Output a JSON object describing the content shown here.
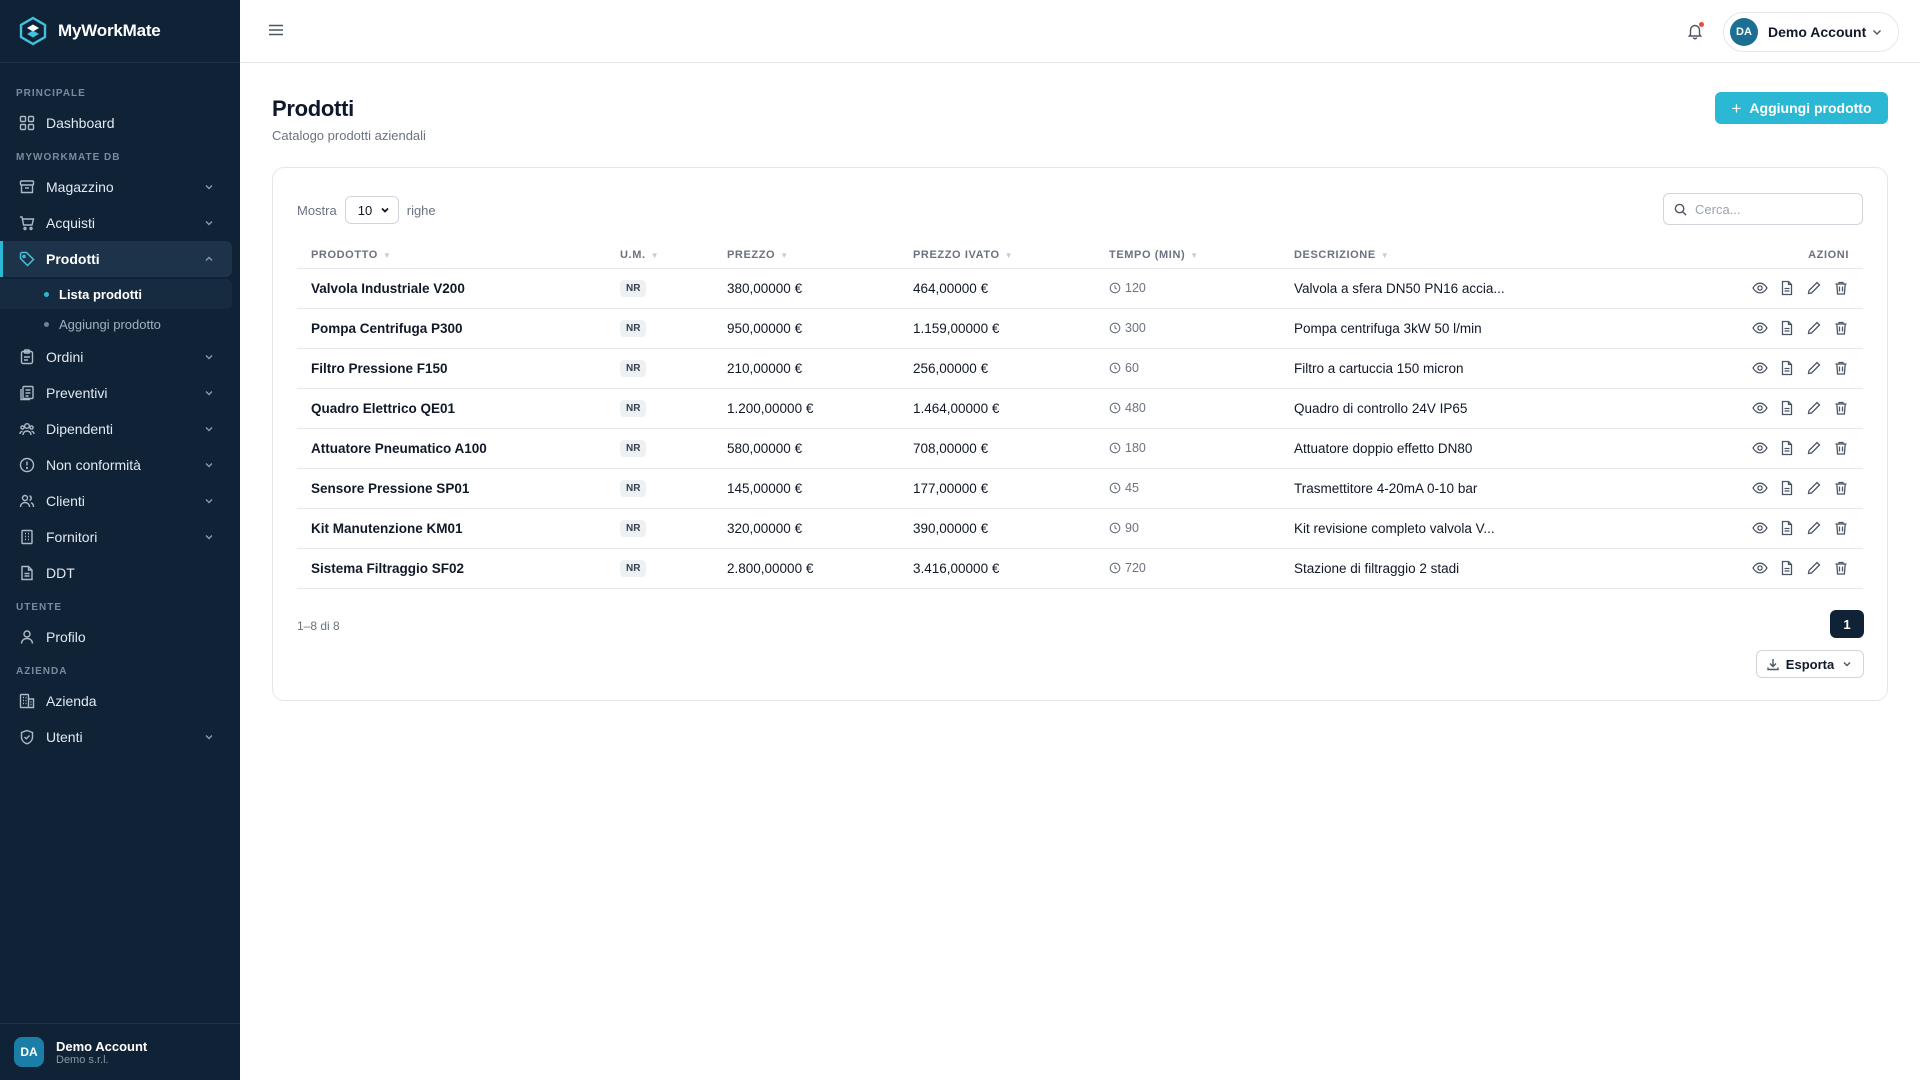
{
  "app": {
    "name": "MyWorkMate"
  },
  "sidebar": {
    "sections": {
      "principale": "PRINCIPALE",
      "db": "MYWORKMATE DB",
      "utente": "UTENTE",
      "azienda": "AZIENDA"
    },
    "items": {
      "dashboard": "Dashboard",
      "magazzino": "Magazzino",
      "acquisti": "Acquisti",
      "prodotti": "Prodotti",
      "lista_prodotti": "Lista prodotti",
      "aggiungi_prodotto": "Aggiungi prodotto",
      "ordini": "Ordini",
      "preventivi": "Preventivi",
      "dipendenti": "Dipendenti",
      "non_conformita": "Non conformità",
      "clienti": "Clienti",
      "fornitori": "Fornitori",
      "ddt": "DDT",
      "profilo": "Profilo",
      "azienda": "Azienda",
      "utenti": "Utenti"
    },
    "footer": {
      "initials": "DA",
      "name": "Demo Account",
      "company": "Demo s.r.l."
    }
  },
  "topbar": {
    "account_initials": "DA",
    "account_name": "Demo Account"
  },
  "page": {
    "title": "Prodotti",
    "subtitle": "Catalogo prodotti aziendali",
    "add_button": "Aggiungi prodotto"
  },
  "table_controls": {
    "show_label": "Mostra",
    "page_size": "10",
    "rows_label": "righe",
    "search_placeholder": "Cerca..."
  },
  "table": {
    "headers": [
      "PRODOTTO",
      "U.M.",
      "PREZZO",
      "PREZZO IVATO",
      "TEMPO (MIN)",
      "DESCRIZIONE",
      "AZIONI"
    ],
    "rows": [
      {
        "name": "Valvola Industriale V200",
        "um": "NR",
        "price": "380,00000 €",
        "price_vat": "464,00000 €",
        "time": "120",
        "desc": "Valvola a sfera DN50 PN16 accia..."
      },
      {
        "name": "Pompa Centrifuga P300",
        "um": "NR",
        "price": "950,00000 €",
        "price_vat": "1.159,00000 €",
        "time": "300",
        "desc": "Pompa centrifuga 3kW 50 l/min"
      },
      {
        "name": "Filtro Pressione F150",
        "um": "NR",
        "price": "210,00000 €",
        "price_vat": "256,00000 €",
        "time": "60",
        "desc": "Filtro a cartuccia 150 micron"
      },
      {
        "name": "Quadro Elettrico QE01",
        "um": "NR",
        "price": "1.200,00000 €",
        "price_vat": "1.464,00000 €",
        "time": "480",
        "desc": "Quadro di controllo 24V IP65"
      },
      {
        "name": "Attuatore Pneumatico A100",
        "um": "NR",
        "price": "580,00000 €",
        "price_vat": "708,00000 €",
        "time": "180",
        "desc": "Attuatore doppio effetto DN80"
      },
      {
        "name": "Sensore Pressione SP01",
        "um": "NR",
        "price": "145,00000 €",
        "price_vat": "177,00000 €",
        "time": "45",
        "desc": "Trasmettitore 4-20mA 0-10 bar"
      },
      {
        "name": "Kit Manutenzione KM01",
        "um": "NR",
        "price": "320,00000 €",
        "price_vat": "390,00000 €",
        "time": "90",
        "desc": "Kit revisione completo valvola V..."
      },
      {
        "name": "Sistema Filtraggio SF02",
        "um": "NR",
        "price": "2.800,00000 €",
        "price_vat": "3.416,00000 €",
        "time": "720",
        "desc": "Stazione di filtraggio 2 stadi"
      }
    ]
  },
  "pagination": {
    "range": "1–8 di 8",
    "current_page": "1"
  },
  "export": {
    "label": "Esporta"
  },
  "colors": {
    "sidebar_bg": "#0f2236",
    "accent": "#2bb8d4",
    "active_page": "#0f2236"
  }
}
